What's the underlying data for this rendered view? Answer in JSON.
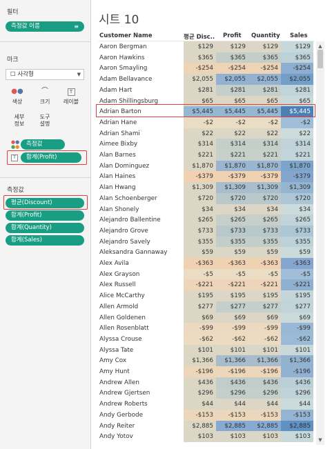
{
  "left_panel": {
    "filters_title": "필터",
    "filter_pill": {
      "label": "측정값 이름",
      "icon": "≡"
    },
    "marks_title": "마크",
    "mark_type": "사각형",
    "mark_buttons": [
      {
        "label": "색상",
        "icon": "color-dots"
      },
      {
        "label": "크기",
        "icon": "size-shapes"
      },
      {
        "label": "레이블",
        "icon": "label-T"
      },
      {
        "label": "세부\n정보",
        "icon": "detail"
      },
      {
        "label": "도구\n설명",
        "icon": "tooltip"
      }
    ],
    "marks_pills": [
      {
        "label": "측정값",
        "icon": "color-dots"
      },
      {
        "label": "합계(Profit)",
        "icon": "T"
      }
    ],
    "measures_title": "측정값",
    "measure_pills": [
      "평균(Discount)",
      "합계(Profit)",
      "합계(Quantity)",
      "합계(Sales)"
    ]
  },
  "sheet": {
    "title": "시트 10",
    "columns": [
      "Customer Name",
      "평균 Disc..",
      "Profit",
      "Quantity",
      "Sales"
    ],
    "highlight_row": "Adrian Barton",
    "colors": {
      "highlight_red": "#e23c3c",
      "pill_green": "#1a9e83",
      "neutral_tan": "#dad4c3",
      "positive_blue": "#8fb9d6",
      "negative_orange": "#f0d5b6"
    },
    "rows": [
      {
        "name": "Aaron Bergman",
        "value": "$129",
        "n": 129
      },
      {
        "name": "Aaron Hawkins",
        "value": "$365",
        "n": 365
      },
      {
        "name": "Aaron Smayling",
        "value": "-$254",
        "n": -254
      },
      {
        "name": "Adam Bellavance",
        "value": "$2,055",
        "n": 2055
      },
      {
        "name": "Adam Hart",
        "value": "$281",
        "n": 281
      },
      {
        "name": "Adam Shillingsburg",
        "value": "$65",
        "n": 65
      },
      {
        "name": "Adrian Barton",
        "value": "$5,445",
        "n": 5445
      },
      {
        "name": "Adrian Hane",
        "value": "-$2",
        "n": -2
      },
      {
        "name": "Adrian Shami",
        "value": "$22",
        "n": 22
      },
      {
        "name": "Aimee Bixby",
        "value": "$314",
        "n": 314
      },
      {
        "name": "Alan Barnes",
        "value": "$221",
        "n": 221
      },
      {
        "name": "Alan Dominguez",
        "value": "$1,870",
        "n": 1870
      },
      {
        "name": "Alan Haines",
        "value": "-$379",
        "n": -379
      },
      {
        "name": "Alan Hwang",
        "value": "$1,309",
        "n": 1309
      },
      {
        "name": "Alan Schoenberger",
        "value": "$720",
        "n": 720
      },
      {
        "name": "Alan Shonely",
        "value": "$34",
        "n": 34
      },
      {
        "name": "Alejandro Ballentine",
        "value": "$265",
        "n": 265
      },
      {
        "name": "Alejandro Grove",
        "value": "$733",
        "n": 733
      },
      {
        "name": "Alejandro Savely",
        "value": "$355",
        "n": 355
      },
      {
        "name": "Aleksandra Gannaway",
        "value": "$59",
        "n": 59
      },
      {
        "name": "Alex Avila",
        "value": "-$363",
        "n": -363
      },
      {
        "name": "Alex Grayson",
        "value": "-$5",
        "n": -5
      },
      {
        "name": "Alex Russell",
        "value": "-$221",
        "n": -221
      },
      {
        "name": "Alice McCarthy",
        "value": "$195",
        "n": 195
      },
      {
        "name": "Allen Armold",
        "value": "$277",
        "n": 277
      },
      {
        "name": "Allen Goldenen",
        "value": "$69",
        "n": 69
      },
      {
        "name": "Allen Rosenblatt",
        "value": "-$99",
        "n": -99
      },
      {
        "name": "Alyssa Crouse",
        "value": "-$62",
        "n": -62
      },
      {
        "name": "Alyssa Tate",
        "value": "$101",
        "n": 101
      },
      {
        "name": "Amy Cox",
        "value": "$1,366",
        "n": 1366
      },
      {
        "name": "Amy Hunt",
        "value": "-$196",
        "n": -196
      },
      {
        "name": "Andrew Allen",
        "value": "$436",
        "n": 436
      },
      {
        "name": "Andrew Gjertsen",
        "value": "$296",
        "n": 296
      },
      {
        "name": "Andrew Roberts",
        "value": "$44",
        "n": 44
      },
      {
        "name": "Andy Gerbode",
        "value": "-$153",
        "n": -153
      },
      {
        "name": "Andy Reiter",
        "value": "$2,885",
        "n": 2885
      },
      {
        "name": "Andy Yotov",
        "value": "$103",
        "n": 103
      }
    ]
  }
}
